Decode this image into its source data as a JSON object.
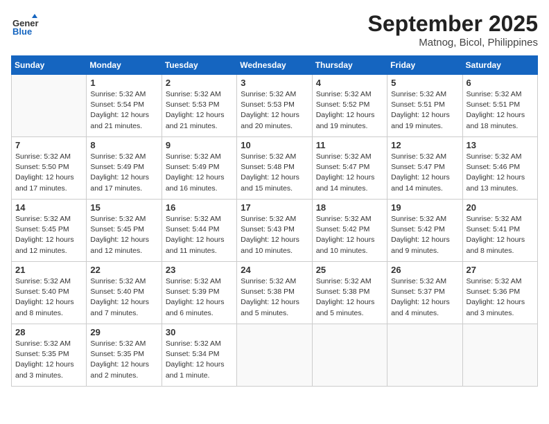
{
  "header": {
    "logo_general": "General",
    "logo_blue": "Blue",
    "month": "September 2025",
    "location": "Matnog, Bicol, Philippines"
  },
  "days_of_week": [
    "Sunday",
    "Monday",
    "Tuesday",
    "Wednesday",
    "Thursday",
    "Friday",
    "Saturday"
  ],
  "weeks": [
    [
      {
        "day": "",
        "info": ""
      },
      {
        "day": "1",
        "info": "Sunrise: 5:32 AM\nSunset: 5:54 PM\nDaylight: 12 hours\nand 21 minutes."
      },
      {
        "day": "2",
        "info": "Sunrise: 5:32 AM\nSunset: 5:53 PM\nDaylight: 12 hours\nand 21 minutes."
      },
      {
        "day": "3",
        "info": "Sunrise: 5:32 AM\nSunset: 5:53 PM\nDaylight: 12 hours\nand 20 minutes."
      },
      {
        "day": "4",
        "info": "Sunrise: 5:32 AM\nSunset: 5:52 PM\nDaylight: 12 hours\nand 19 minutes."
      },
      {
        "day": "5",
        "info": "Sunrise: 5:32 AM\nSunset: 5:51 PM\nDaylight: 12 hours\nand 19 minutes."
      },
      {
        "day": "6",
        "info": "Sunrise: 5:32 AM\nSunset: 5:51 PM\nDaylight: 12 hours\nand 18 minutes."
      }
    ],
    [
      {
        "day": "7",
        "info": "Sunrise: 5:32 AM\nSunset: 5:50 PM\nDaylight: 12 hours\nand 17 minutes."
      },
      {
        "day": "8",
        "info": "Sunrise: 5:32 AM\nSunset: 5:49 PM\nDaylight: 12 hours\nand 17 minutes."
      },
      {
        "day": "9",
        "info": "Sunrise: 5:32 AM\nSunset: 5:49 PM\nDaylight: 12 hours\nand 16 minutes."
      },
      {
        "day": "10",
        "info": "Sunrise: 5:32 AM\nSunset: 5:48 PM\nDaylight: 12 hours\nand 15 minutes."
      },
      {
        "day": "11",
        "info": "Sunrise: 5:32 AM\nSunset: 5:47 PM\nDaylight: 12 hours\nand 14 minutes."
      },
      {
        "day": "12",
        "info": "Sunrise: 5:32 AM\nSunset: 5:47 PM\nDaylight: 12 hours\nand 14 minutes."
      },
      {
        "day": "13",
        "info": "Sunrise: 5:32 AM\nSunset: 5:46 PM\nDaylight: 12 hours\nand 13 minutes."
      }
    ],
    [
      {
        "day": "14",
        "info": "Sunrise: 5:32 AM\nSunset: 5:45 PM\nDaylight: 12 hours\nand 12 minutes."
      },
      {
        "day": "15",
        "info": "Sunrise: 5:32 AM\nSunset: 5:45 PM\nDaylight: 12 hours\nand 12 minutes."
      },
      {
        "day": "16",
        "info": "Sunrise: 5:32 AM\nSunset: 5:44 PM\nDaylight: 12 hours\nand 11 minutes."
      },
      {
        "day": "17",
        "info": "Sunrise: 5:32 AM\nSunset: 5:43 PM\nDaylight: 12 hours\nand 10 minutes."
      },
      {
        "day": "18",
        "info": "Sunrise: 5:32 AM\nSunset: 5:42 PM\nDaylight: 12 hours\nand 10 minutes."
      },
      {
        "day": "19",
        "info": "Sunrise: 5:32 AM\nSunset: 5:42 PM\nDaylight: 12 hours\nand 9 minutes."
      },
      {
        "day": "20",
        "info": "Sunrise: 5:32 AM\nSunset: 5:41 PM\nDaylight: 12 hours\nand 8 minutes."
      }
    ],
    [
      {
        "day": "21",
        "info": "Sunrise: 5:32 AM\nSunset: 5:40 PM\nDaylight: 12 hours\nand 8 minutes."
      },
      {
        "day": "22",
        "info": "Sunrise: 5:32 AM\nSunset: 5:40 PM\nDaylight: 12 hours\nand 7 minutes."
      },
      {
        "day": "23",
        "info": "Sunrise: 5:32 AM\nSunset: 5:39 PM\nDaylight: 12 hours\nand 6 minutes."
      },
      {
        "day": "24",
        "info": "Sunrise: 5:32 AM\nSunset: 5:38 PM\nDaylight: 12 hours\nand 5 minutes."
      },
      {
        "day": "25",
        "info": "Sunrise: 5:32 AM\nSunset: 5:38 PM\nDaylight: 12 hours\nand 5 minutes."
      },
      {
        "day": "26",
        "info": "Sunrise: 5:32 AM\nSunset: 5:37 PM\nDaylight: 12 hours\nand 4 minutes."
      },
      {
        "day": "27",
        "info": "Sunrise: 5:32 AM\nSunset: 5:36 PM\nDaylight: 12 hours\nand 3 minutes."
      }
    ],
    [
      {
        "day": "28",
        "info": "Sunrise: 5:32 AM\nSunset: 5:35 PM\nDaylight: 12 hours\nand 3 minutes."
      },
      {
        "day": "29",
        "info": "Sunrise: 5:32 AM\nSunset: 5:35 PM\nDaylight: 12 hours\nand 2 minutes."
      },
      {
        "day": "30",
        "info": "Sunrise: 5:32 AM\nSunset: 5:34 PM\nDaylight: 12 hours\nand 1 minute."
      },
      {
        "day": "",
        "info": ""
      },
      {
        "day": "",
        "info": ""
      },
      {
        "day": "",
        "info": ""
      },
      {
        "day": "",
        "info": ""
      }
    ]
  ]
}
